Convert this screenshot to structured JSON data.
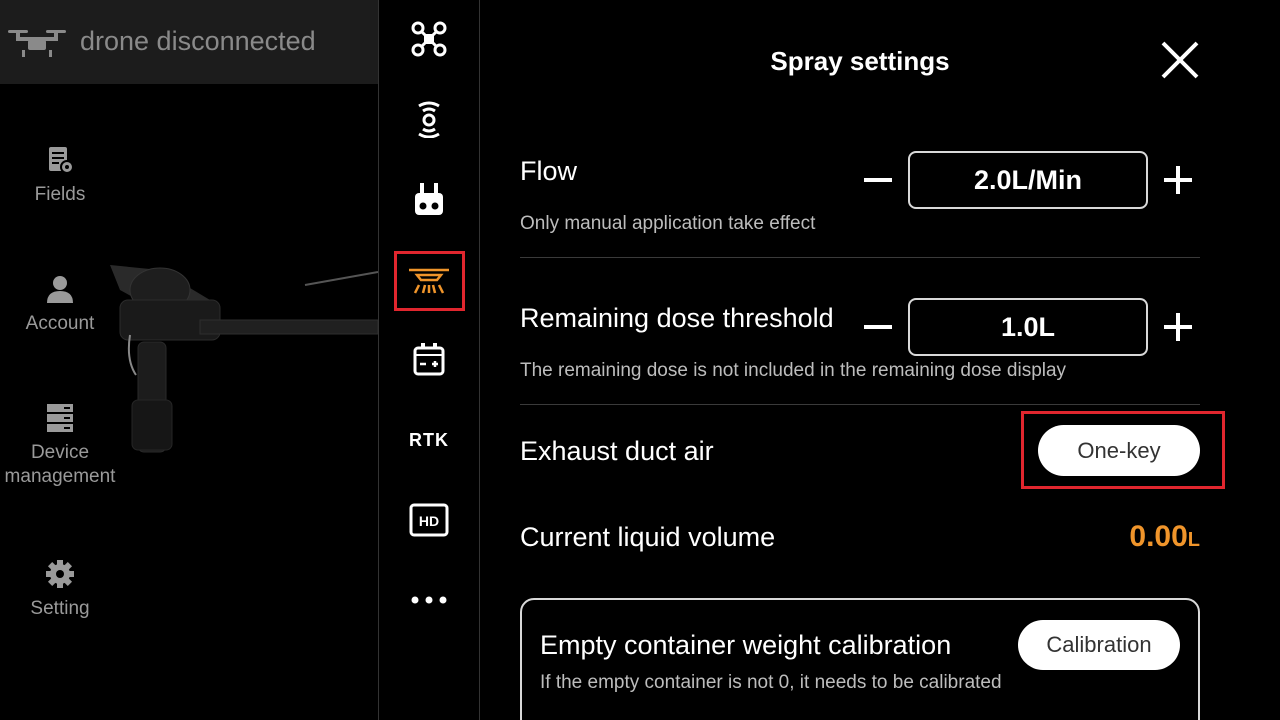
{
  "status": {
    "text": "drone disconnected",
    "icon": "drone-icon"
  },
  "sidebar": {
    "items": [
      {
        "label": "Fields",
        "icon": "fields-icon"
      },
      {
        "label": "Account",
        "icon": "account-icon"
      },
      {
        "label": "Device\nmanagement",
        "icon": "device-icon"
      },
      {
        "label": "Setting",
        "icon": "gear-icon"
      }
    ]
  },
  "icon_column": {
    "items": [
      "drone-icon",
      "signal-icon",
      "remote-controller-icon",
      "spray-icon",
      "battery-icon",
      "rtk",
      "hd-icon",
      "more-icon"
    ],
    "rtk_label": "RTK",
    "hd_label": "HD",
    "selected": "spray-icon"
  },
  "panel": {
    "title": "Spray settings",
    "flow": {
      "label": "Flow",
      "value": "2.0L/Min",
      "sub": "Only manual application take effect"
    },
    "dose": {
      "label": "Remaining dose threshold",
      "value": "1.0L",
      "sub": "The remaining dose is not included in the remaining dose display"
    },
    "exhaust": {
      "label": "Exhaust duct air",
      "button": "One-key"
    },
    "liquid": {
      "label": "Current liquid volume",
      "value": "0.00",
      "unit": "L"
    },
    "calibration": {
      "title": "Empty container weight calibration",
      "sub": "If the empty container is not 0, it needs to be calibrated",
      "button": "Calibration"
    }
  },
  "colors": {
    "accent": "#f0952b",
    "highlight": "#e0262e",
    "background": "#000000"
  }
}
